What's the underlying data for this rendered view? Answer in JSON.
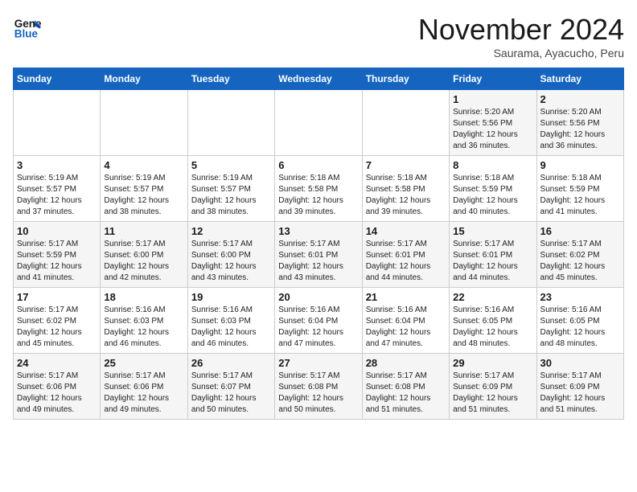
{
  "header": {
    "logo_line1": "General",
    "logo_line2": "Blue",
    "month": "November 2024",
    "location": "Saurama, Ayacucho, Peru"
  },
  "weekdays": [
    "Sunday",
    "Monday",
    "Tuesday",
    "Wednesday",
    "Thursday",
    "Friday",
    "Saturday"
  ],
  "weeks": [
    [
      {
        "day": "",
        "info": ""
      },
      {
        "day": "",
        "info": ""
      },
      {
        "day": "",
        "info": ""
      },
      {
        "day": "",
        "info": ""
      },
      {
        "day": "",
        "info": ""
      },
      {
        "day": "1",
        "info": "Sunrise: 5:20 AM\nSunset: 5:56 PM\nDaylight: 12 hours\nand 36 minutes."
      },
      {
        "day": "2",
        "info": "Sunrise: 5:20 AM\nSunset: 5:56 PM\nDaylight: 12 hours\nand 36 minutes."
      }
    ],
    [
      {
        "day": "3",
        "info": "Sunrise: 5:19 AM\nSunset: 5:57 PM\nDaylight: 12 hours\nand 37 minutes."
      },
      {
        "day": "4",
        "info": "Sunrise: 5:19 AM\nSunset: 5:57 PM\nDaylight: 12 hours\nand 38 minutes."
      },
      {
        "day": "5",
        "info": "Sunrise: 5:19 AM\nSunset: 5:57 PM\nDaylight: 12 hours\nand 38 minutes."
      },
      {
        "day": "6",
        "info": "Sunrise: 5:18 AM\nSunset: 5:58 PM\nDaylight: 12 hours\nand 39 minutes."
      },
      {
        "day": "7",
        "info": "Sunrise: 5:18 AM\nSunset: 5:58 PM\nDaylight: 12 hours\nand 39 minutes."
      },
      {
        "day": "8",
        "info": "Sunrise: 5:18 AM\nSunset: 5:59 PM\nDaylight: 12 hours\nand 40 minutes."
      },
      {
        "day": "9",
        "info": "Sunrise: 5:18 AM\nSunset: 5:59 PM\nDaylight: 12 hours\nand 41 minutes."
      }
    ],
    [
      {
        "day": "10",
        "info": "Sunrise: 5:17 AM\nSunset: 5:59 PM\nDaylight: 12 hours\nand 41 minutes."
      },
      {
        "day": "11",
        "info": "Sunrise: 5:17 AM\nSunset: 6:00 PM\nDaylight: 12 hours\nand 42 minutes."
      },
      {
        "day": "12",
        "info": "Sunrise: 5:17 AM\nSunset: 6:00 PM\nDaylight: 12 hours\nand 43 minutes."
      },
      {
        "day": "13",
        "info": "Sunrise: 5:17 AM\nSunset: 6:01 PM\nDaylight: 12 hours\nand 43 minutes."
      },
      {
        "day": "14",
        "info": "Sunrise: 5:17 AM\nSunset: 6:01 PM\nDaylight: 12 hours\nand 44 minutes."
      },
      {
        "day": "15",
        "info": "Sunrise: 5:17 AM\nSunset: 6:01 PM\nDaylight: 12 hours\nand 44 minutes."
      },
      {
        "day": "16",
        "info": "Sunrise: 5:17 AM\nSunset: 6:02 PM\nDaylight: 12 hours\nand 45 minutes."
      }
    ],
    [
      {
        "day": "17",
        "info": "Sunrise: 5:17 AM\nSunset: 6:02 PM\nDaylight: 12 hours\nand 45 minutes."
      },
      {
        "day": "18",
        "info": "Sunrise: 5:16 AM\nSunset: 6:03 PM\nDaylight: 12 hours\nand 46 minutes."
      },
      {
        "day": "19",
        "info": "Sunrise: 5:16 AM\nSunset: 6:03 PM\nDaylight: 12 hours\nand 46 minutes."
      },
      {
        "day": "20",
        "info": "Sunrise: 5:16 AM\nSunset: 6:04 PM\nDaylight: 12 hours\nand 47 minutes."
      },
      {
        "day": "21",
        "info": "Sunrise: 5:16 AM\nSunset: 6:04 PM\nDaylight: 12 hours\nand 47 minutes."
      },
      {
        "day": "22",
        "info": "Sunrise: 5:16 AM\nSunset: 6:05 PM\nDaylight: 12 hours\nand 48 minutes."
      },
      {
        "day": "23",
        "info": "Sunrise: 5:16 AM\nSunset: 6:05 PM\nDaylight: 12 hours\nand 48 minutes."
      }
    ],
    [
      {
        "day": "24",
        "info": "Sunrise: 5:17 AM\nSunset: 6:06 PM\nDaylight: 12 hours\nand 49 minutes."
      },
      {
        "day": "25",
        "info": "Sunrise: 5:17 AM\nSunset: 6:06 PM\nDaylight: 12 hours\nand 49 minutes."
      },
      {
        "day": "26",
        "info": "Sunrise: 5:17 AM\nSunset: 6:07 PM\nDaylight: 12 hours\nand 50 minutes."
      },
      {
        "day": "27",
        "info": "Sunrise: 5:17 AM\nSunset: 6:08 PM\nDaylight: 12 hours\nand 50 minutes."
      },
      {
        "day": "28",
        "info": "Sunrise: 5:17 AM\nSunset: 6:08 PM\nDaylight: 12 hours\nand 51 minutes."
      },
      {
        "day": "29",
        "info": "Sunrise: 5:17 AM\nSunset: 6:09 PM\nDaylight: 12 hours\nand 51 minutes."
      },
      {
        "day": "30",
        "info": "Sunrise: 5:17 AM\nSunset: 6:09 PM\nDaylight: 12 hours\nand 51 minutes."
      }
    ]
  ]
}
